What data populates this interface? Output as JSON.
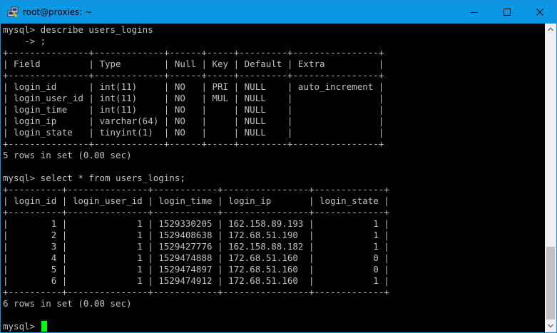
{
  "window": {
    "title": "root@proxies: ~",
    "icon": "putty-icon",
    "controls": {
      "minimize": "minimize-icon",
      "maximize": "maximize-icon",
      "close": "close-icon"
    }
  },
  "colors": {
    "titlebar": "#0b97e4",
    "terminal_bg": "#000000",
    "terminal_fg": "#c0c0c0",
    "cursor": "#00ff00"
  },
  "terminal": {
    "lines": [
      "mysql> describe users_logins",
      "    -> ;",
      "+---------------+-------------+------+-----+---------+----------------+",
      "| Field         | Type        | Null | Key | Default | Extra          |",
      "+---------------+-------------+------+-----+---------+----------------+",
      "| login_id      | int(11)     | NO   | PRI | NULL    | auto_increment |",
      "| login_user_id | int(11)     | NO   | MUL | NULL    |                |",
      "| login_time    | int(11)     | NO   |     | NULL    |                |",
      "| login_ip      | varchar(64) | NO   |     | NULL    |                |",
      "| login_state   | tinyint(1)  | NO   |     | NULL    |                |",
      "+---------------+-------------+------+-----+---------+----------------+",
      "5 rows in set (0.00 sec)",
      "",
      "mysql> select * from users_logins;",
      "+----------+---------------+------------+----------------+-------------+",
      "| login_id | login_user_id | login_time | login_ip       | login_state |",
      "+----------+---------------+------------+----------------+-------------+",
      "|        1 |             1 | 1529330205 | 162.158.89.193 |           1 |",
      "|        2 |             1 | 1529408638 | 172.68.51.190  |           1 |",
      "|        3 |             1 | 1529427776 | 162.158.88.182 |           1 |",
      "|        4 |             1 | 1529474888 | 172.68.51.160  |           0 |",
      "|        5 |             1 | 1529474897 | 172.68.51.160  |           0 |",
      "|        6 |             1 | 1529474912 | 172.68.51.160  |           1 |",
      "+----------+---------------+------------+----------------+-------------+",
      "6 rows in set (0.00 sec)",
      ""
    ],
    "prompt": "mysql> "
  },
  "scrollbar": {
    "up": "scroll-up-arrow-icon",
    "down": "scroll-down-arrow-icon"
  }
}
